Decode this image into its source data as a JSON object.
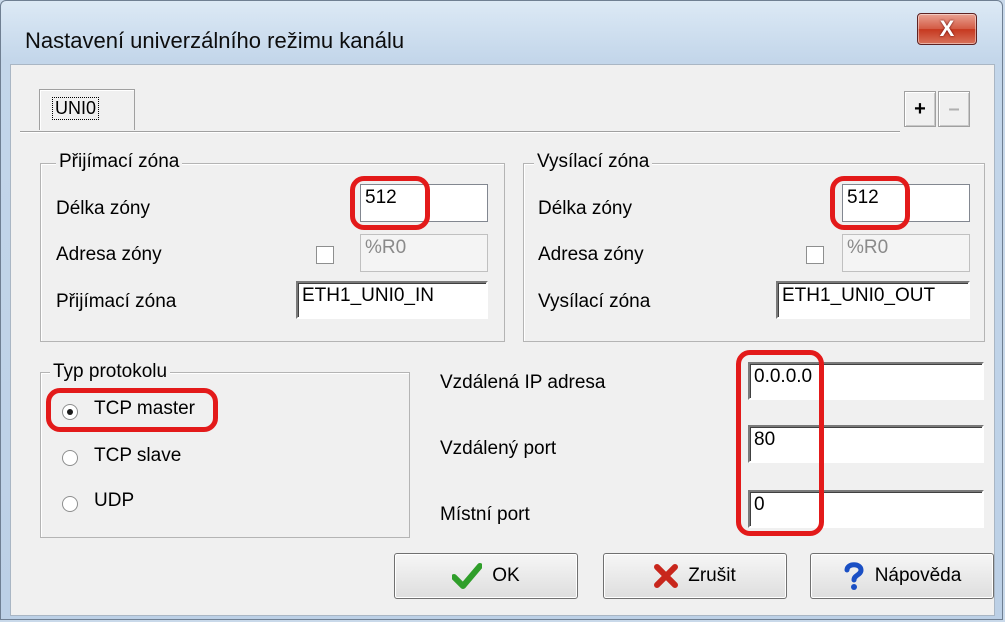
{
  "window": {
    "title": "Nastavení univerzálního režimu kanálu",
    "close_label": "X"
  },
  "tabs": [
    {
      "label": "UNI0",
      "selected": true
    }
  ],
  "tab_buttons": {
    "add_label": "+",
    "remove_label": "–"
  },
  "receive_zone": {
    "group_title": "Přijímací zóna",
    "length_label": "Délka zóny",
    "length_value": "512",
    "address_label": "Adresa zóny",
    "address_checked": false,
    "address_value": "%R0",
    "zone_label": "Přijímací zóna",
    "zone_value": "ETH1_UNI0_IN"
  },
  "send_zone": {
    "group_title": "Vysílací zóna",
    "length_label": "Délka zóny",
    "length_value": "512",
    "address_label": "Adresa zóny",
    "address_checked": false,
    "address_value": "%R0",
    "zone_label": "Vysílací zóna",
    "zone_value": "ETH1_UNI0_OUT"
  },
  "protocol": {
    "group_title": "Typ protokolu",
    "options": [
      {
        "label": "TCP master",
        "checked": true
      },
      {
        "label": "TCP slave",
        "checked": false
      },
      {
        "label": "UDP",
        "checked": false
      }
    ]
  },
  "remote": {
    "ip_label": "Vzdálená IP adresa",
    "ip_value": "0.0.0.0",
    "port_label": "Vzdálený port",
    "port_value": "80",
    "local_port_label": "Místní port",
    "local_port_value": "0"
  },
  "buttons": {
    "ok_label": "OK",
    "cancel_label": "Zrušit",
    "help_label": "Nápověda"
  },
  "icons": {
    "ok": "checkmark-icon",
    "cancel": "x-icon",
    "help": "question-icon"
  },
  "colors": {
    "highlight_red": "#e31a1a",
    "ok_green": "#2f9e2a",
    "cancel_red": "#c8261c",
    "help_blue": "#1a4fc4"
  }
}
